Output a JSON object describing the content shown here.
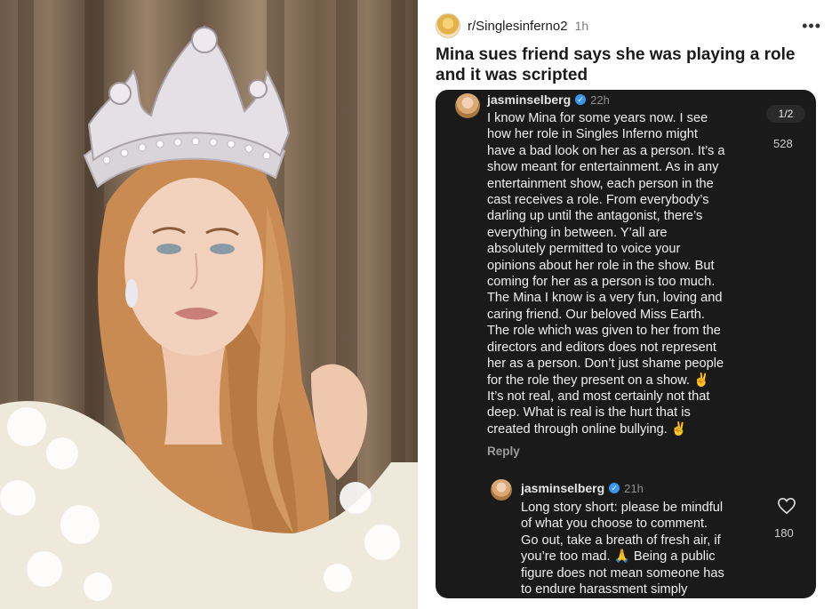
{
  "post": {
    "subreddit": "r/Singlesinferno2",
    "age": "1h",
    "more_icon": "ellipsis-icon",
    "title_line1": "Mina sues friend says she was playing a role",
    "title_line2": "and it was scripted"
  },
  "comment1": {
    "username": "jasminselberg",
    "time": "22h",
    "pager": "1/2",
    "likes": "528",
    "lines": [
      "I know Mina for some years now. I see",
      "how her role in Singles Inferno might",
      "have a bad look on her as a person. It’s a",
      "show meant for entertainment. As in any",
      "entertainment show, each person in the",
      "cast receives a role. From everybody’s",
      "darling up until the antagonist, there’s",
      "everything in between. Y’all are",
      "absolutely permitted to voice your",
      "opinions about her role in the show. But",
      "coming for her as a person is too much.",
      "The Mina I know is a very fun, loving and",
      "caring friend. Our beloved Miss Earth.",
      "The role which was given to her from the",
      "directors and editors does not represent",
      "her as a person. Don’t just shame people",
      "for the role they present on a show. ✌️",
      "It’s not real, and most certainly not that",
      "deep. What is real is the hurt that is",
      "created through online bullying. ✌️"
    ],
    "reply_label": "Reply"
  },
  "comment2": {
    "username": "jasminselberg",
    "time": "21h",
    "likes": "180",
    "heart_icon": "heart-icon",
    "lines": [
      "Long story short: please be mindful",
      "of what you choose to comment.",
      "Go out, take a breath of fresh air, if",
      "you’re too mad. 🙏  Being a public",
      "figure does not mean someone has",
      "to endure harassment simply"
    ]
  },
  "colors": {
    "card_bg": "#1a1a1b",
    "verified": "#3897f0"
  }
}
